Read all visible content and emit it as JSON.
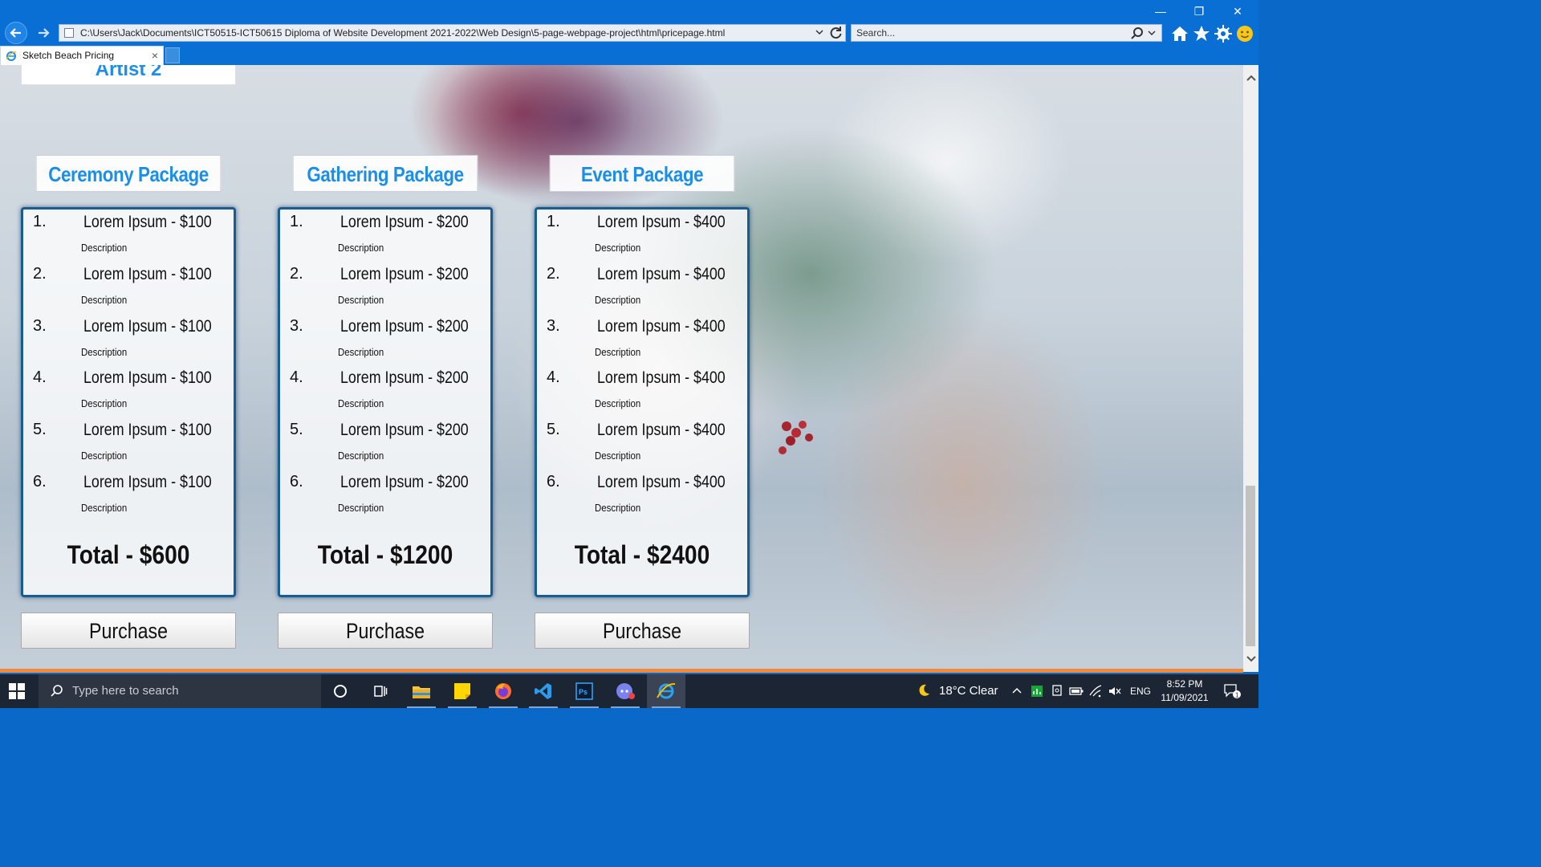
{
  "browser": {
    "address": "C:\\Users\\Jack\\Documents\\ICT50515-ICT50615 Diploma of Website Development 2021-2022\\Web Design\\5-page-webpage-project\\html\\pricepage.html",
    "search_placeholder": "Search...",
    "tab_title": "Sketch Beach Pricing",
    "tab_close": "×",
    "win_min": "—",
    "win_restore": "❐",
    "win_close": "✕"
  },
  "page": {
    "artist_heading": "Artist 2",
    "packages": [
      {
        "title": "Ceremony Package",
        "items": [
          {
            "num": "1.",
            "name": "Lorem Ipsum - $100",
            "desc": "Description"
          },
          {
            "num": "2.",
            "name": "Lorem Ipsum - $100",
            "desc": "Description"
          },
          {
            "num": "3.",
            "name": "Lorem Ipsum - $100",
            "desc": "Description"
          },
          {
            "num": "4.",
            "name": "Lorem Ipsum - $100",
            "desc": "Description"
          },
          {
            "num": "5.",
            "name": "Lorem Ipsum - $100",
            "desc": "Description"
          },
          {
            "num": "6.",
            "name": "Lorem Ipsum - $100",
            "desc": "Description"
          }
        ],
        "total": "Total - $600",
        "button": "Purchase"
      },
      {
        "title": "Gathering Package",
        "items": [
          {
            "num": "1.",
            "name": "Lorem Ipsum - $200",
            "desc": "Description"
          },
          {
            "num": "2.",
            "name": "Lorem Ipsum - $200",
            "desc": "Description"
          },
          {
            "num": "3.",
            "name": "Lorem Ipsum - $200",
            "desc": "Description"
          },
          {
            "num": "4.",
            "name": "Lorem Ipsum - $200",
            "desc": "Description"
          },
          {
            "num": "5.",
            "name": "Lorem Ipsum - $200",
            "desc": "Description"
          },
          {
            "num": "6.",
            "name": "Lorem Ipsum - $200",
            "desc": "Description"
          }
        ],
        "total": "Total - $1200",
        "button": "Purchase"
      },
      {
        "title": "Event Package",
        "items": [
          {
            "num": "1.",
            "name": "Lorem Ipsum - $400",
            "desc": "Description"
          },
          {
            "num": "2.",
            "name": "Lorem Ipsum - $400",
            "desc": "Description"
          },
          {
            "num": "3.",
            "name": "Lorem Ipsum - $400",
            "desc": "Description"
          },
          {
            "num": "4.",
            "name": "Lorem Ipsum - $400",
            "desc": "Description"
          },
          {
            "num": "5.",
            "name": "Lorem Ipsum - $400",
            "desc": "Description"
          },
          {
            "num": "6.",
            "name": "Lorem Ipsum - $400",
            "desc": "Description"
          }
        ],
        "total": "Total - $2400",
        "button": "Purchase"
      }
    ]
  },
  "taskbar": {
    "search_placeholder": "Type here to search",
    "weather": "18°C  Clear",
    "language": "ENG",
    "time": "8:52 PM",
    "date": "11/09/2021",
    "notification_count": "1",
    "apps": [
      "cortana-icon",
      "task-view-icon",
      "file-explorer-icon",
      "sticky-notes-icon",
      "firefox-icon",
      "vscode-icon",
      "photoshop-icon",
      "discord-icon",
      "internet-explorer-icon"
    ]
  },
  "colors": {
    "accent": "#1b8fe8",
    "chrome_blue": "#0a6fd4",
    "card_border": "#1a5c92",
    "taskbar": "#1c2533",
    "accent_line": "#f08a3c"
  }
}
